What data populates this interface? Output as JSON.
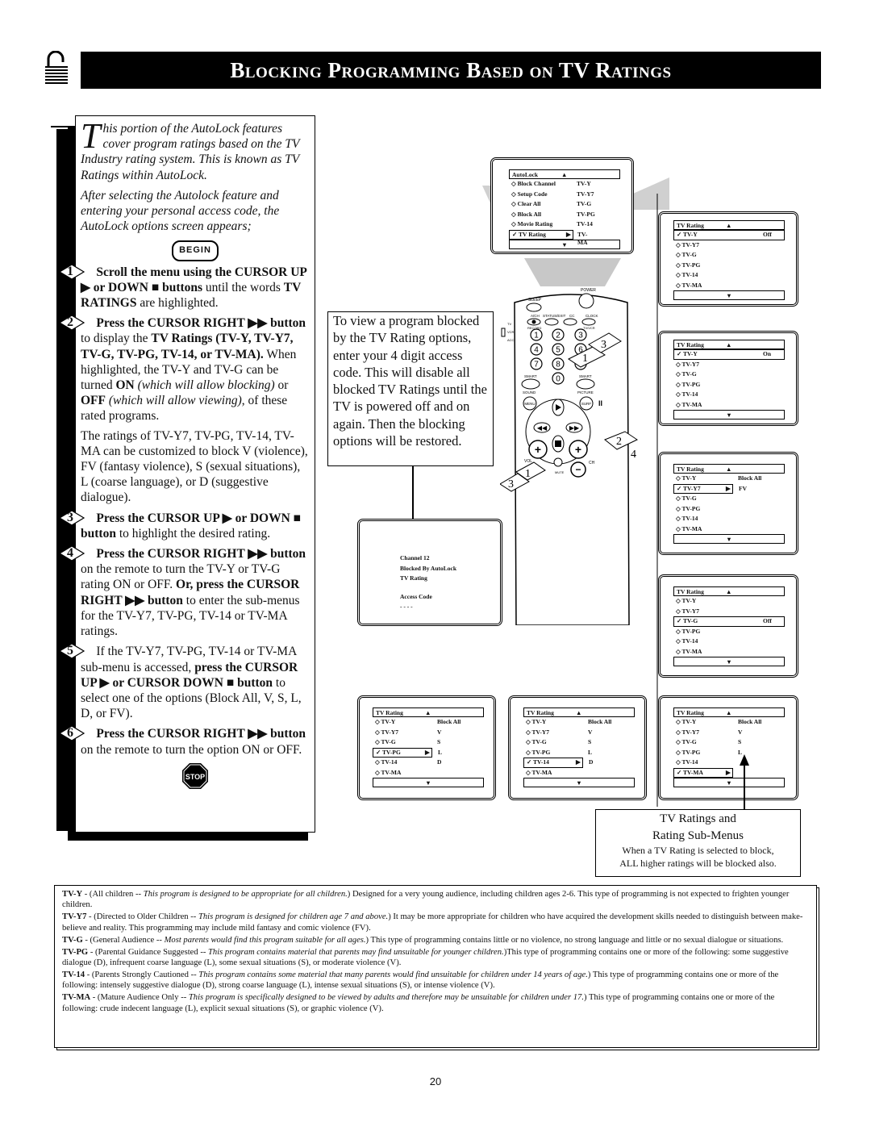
{
  "header": {
    "title": "Blocking Programming Based on TV Ratings",
    "icon": "padlock-icon"
  },
  "instructions": {
    "intro_dropcap": "T",
    "intro_1": "his portion of the AutoLock features cover program ratings based on the TV Industry rating system. This is known as TV Ratings within AutoLock.",
    "intro_2": "After selecting the Autolock feature and entering your personal access code, the AutoLock options screen appears;",
    "begin_label": "BEGIN",
    "steps": [
      {
        "num": "1",
        "bold": "Scroll the menu using the CURSOR UP ▶ or DOWN ■ buttons",
        "text": " until the words ",
        "bold2": "TV RATINGS",
        "text2": " are highlighted."
      },
      {
        "num": "2",
        "bold": "Press the CURSOR RIGHT ▶▶ button",
        "text": " to display the ",
        "bold2": "TV Ratings (TV-Y, TV-Y7, TV-G, TV-PG, TV-14, or TV-MA).",
        "text2": " When highlighted, the TV-Y and TV-G can be turned ",
        "bold3": "ON",
        "ital3": " (which will allow blocking)",
        "text3": " or ",
        "bold4": "OFF",
        "ital4": " (which will allow viewing)",
        "text4": ", of these rated programs.",
        "extra": "The ratings of TV-Y7, TV-PG, TV-14, TV-MA can be customized to block V (violence), FV (fantasy violence), S (sexual situations), L (coarse language), or D (suggestive dialogue)."
      },
      {
        "num": "3",
        "bold": "Press the CURSOR UP ▶ or DOWN ■ button",
        "text": " to highlight the desired rating."
      },
      {
        "num": "4",
        "bold": "Press the CURSOR RIGHT ▶▶ button",
        "text": " on the remote to turn the TV-Y or TV-G rating ON or OFF. ",
        "bold2": "Or, press the CURSOR RIGHT ▶▶ button",
        "text2": " to enter the sub-menus for the TV-Y7, TV-PG, TV-14 or TV-MA ratings."
      },
      {
        "num": "5",
        "text": "If the TV-Y7, TV-PG, TV-14 or TV-MA sub-menu is accessed, ",
        "bold": "press the CURSOR UP ▶ or CURSOR DOWN ■ button",
        "text2": " to select one of the options (Block All, V, S, L, D, or FV)."
      },
      {
        "num": "6",
        "bold": "Press the CURSOR RIGHT ▶▶ button",
        "text": " on the remote to turn the option ON or OFF."
      }
    ],
    "stop_label": "STOP"
  },
  "infobox": {
    "text": "To view a program blocked by the TV Rating options, enter your 4 digit access code. This will disable all blocked TV Ratings until the TV is powered off and on again. Then the blocking options will be restored."
  },
  "autolock_menu": {
    "header": "AutoLock",
    "items": [
      {
        "label": "Block Channel",
        "value": "TV-Y"
      },
      {
        "label": "Setup Code",
        "value": "TV-Y7"
      },
      {
        "label": "Clear All",
        "value": "TV-G"
      },
      {
        "label": "Block All",
        "value": "TV-PG"
      },
      {
        "label": "Movie Rating",
        "value": "TV-14"
      },
      {
        "label": "TV Rating",
        "value": "TV-MA",
        "selected": true
      }
    ]
  },
  "blocked_screen": {
    "line1": "Channel 12",
    "line2": "Blocked By AutoLock",
    "line3": "TV Rating",
    "line4": "Access Code",
    "line5": "- - - -"
  },
  "rating_menus": [
    {
      "header": "TV Rating",
      "rows": [
        {
          "label": "TV-Y",
          "value": "Off",
          "selected": true
        },
        {
          "label": "TV-Y7",
          "value": ""
        },
        {
          "label": "TV-G",
          "value": ""
        },
        {
          "label": "TV-PG",
          "value": ""
        },
        {
          "label": "TV-14",
          "value": ""
        },
        {
          "label": "TV-MA",
          "value": ""
        }
      ]
    },
    {
      "header": "TV Rating",
      "rows": [
        {
          "label": "TV-Y",
          "value": "On",
          "selected": true
        },
        {
          "label": "TV-Y7",
          "value": ""
        },
        {
          "label": "TV-G",
          "value": ""
        },
        {
          "label": "TV-PG",
          "value": ""
        },
        {
          "label": "TV-14",
          "value": ""
        },
        {
          "label": "TV-MA",
          "value": ""
        }
      ]
    },
    {
      "header": "TV Rating",
      "rows": [
        {
          "label": "TV-Y",
          "value": "Block All"
        },
        {
          "label": "TV-Y7",
          "value": "FV",
          "selected": true,
          "arrow": true
        },
        {
          "label": "TV-G",
          "value": ""
        },
        {
          "label": "TV-PG",
          "value": ""
        },
        {
          "label": "TV-14",
          "value": ""
        },
        {
          "label": "TV-MA",
          "value": ""
        }
      ]
    },
    {
      "header": "TV Rating",
      "rows": [
        {
          "label": "TV-Y",
          "value": ""
        },
        {
          "label": "TV-Y7",
          "value": ""
        },
        {
          "label": "TV-G",
          "value": "Off",
          "selected": true
        },
        {
          "label": "TV-PG",
          "value": ""
        },
        {
          "label": "TV-14",
          "value": ""
        },
        {
          "label": "TV-MA",
          "value": ""
        }
      ]
    },
    {
      "header": "TV Rating",
      "rows": [
        {
          "label": "TV-Y",
          "value": "Block All"
        },
        {
          "label": "TV-Y7",
          "value": "V"
        },
        {
          "label": "TV-G",
          "value": "S"
        },
        {
          "label": "TV-PG",
          "value": "L",
          "selected": true,
          "arrow": true
        },
        {
          "label": "TV-14",
          "value": "D"
        },
        {
          "label": "TV-MA",
          "value": ""
        }
      ]
    },
    {
      "header": "TV Rating",
      "rows": [
        {
          "label": "TV-Y",
          "value": "Block All"
        },
        {
          "label": "TV-Y7",
          "value": "V"
        },
        {
          "label": "TV-G",
          "value": "S"
        },
        {
          "label": "TV-PG",
          "value": "L"
        },
        {
          "label": "TV-14",
          "value": "D",
          "selected": true,
          "arrow": true
        },
        {
          "label": "TV-MA",
          "value": ""
        }
      ]
    },
    {
      "header": "TV Rating",
      "rows": [
        {
          "label": "TV-Y",
          "value": "Block All"
        },
        {
          "label": "TV-Y7",
          "value": "V"
        },
        {
          "label": "TV-G",
          "value": "S"
        },
        {
          "label": "TV-PG",
          "value": "L"
        },
        {
          "label": "TV-14",
          "value": ""
        },
        {
          "label": "TV-MA",
          "value": "",
          "selected": true,
          "arrow": true
        }
      ]
    }
  ],
  "remote": {
    "labels": {
      "sleep": "SLEEP",
      "power": "POWER",
      "ach": "A/CH",
      "status": "STATUS/EXIT",
      "cc": "CC",
      "clock": "CLOCK",
      "record": "RECORD",
      "tvvcr": "TV/VCR",
      "tv": "TV",
      "vcr": "VCR",
      "acc": "ACC",
      "smart1": "SMART",
      "smart2": "SMART",
      "sound": "SOUND",
      "picture": "PICTURE",
      "menu": "MENU",
      "surf": "SURF",
      "vol": "VOL",
      "ch": "CH",
      "mute": "MUTE"
    },
    "digits": [
      "1",
      "2",
      "3",
      "4",
      "5",
      "6",
      "7",
      "8",
      "9",
      "0"
    ],
    "step_callouts": [
      "1",
      "3",
      "2",
      "4",
      "3",
      "1"
    ]
  },
  "caption": {
    "title1": "TV Ratings and",
    "title2": "Rating Sub-Menus",
    "note1": "When a TV Rating is selected to block,",
    "note2": "ALL higher ratings will be blocked also."
  },
  "definitions": [
    {
      "term": "TV-Y",
      "plain1": " - (All children -- ",
      "italic": "This program is designed to be appropriate for all children.",
      "plain2": ") Designed for a very young audience, including children ages 2-6. This type of programming is not expected to frighten younger children."
    },
    {
      "term": "TV-Y7",
      "plain1": " - (Directed to Older Children -- ",
      "italic": "This program is designed for children age 7 and above.",
      "plain2": ") It may be more appropriate for children who have acquired the development skills needed to distinguish between make-believe and reality. This programming may include mild fantasy and comic violence (FV)."
    },
    {
      "term": "TV-G",
      "plain1": " - (General Audience -- ",
      "italic": "Most parents would find this program suitable for all ages.",
      "plain2": ") This type of programming contains little or no violence, no strong language and little or no sexual dialogue or situations."
    },
    {
      "term": "TV-PG",
      "plain1": " - (Parental Guidance Suggested -- ",
      "italic": "This program contains material that parents may find unsuitable for younger children.",
      "plain2": ")This type of programming contains one or more of the following: some suggestive dialogue (D), infrequent coarse language (L), some sexual situations (S), or moderate violence (V)."
    },
    {
      "term": "TV-14",
      "plain1": " - (Parents Strongly Cautioned -- ",
      "italic": "This program contains some material that many parents would find unsuitable for children under 14 years of age.",
      "plain2": ") This type of programming contains one or more of the following: intensely suggestive dialogue (D), strong coarse language (L), intense sexual situations (S), or intense violence (V)."
    },
    {
      "term": "TV-MA",
      "plain1": " - (Mature Audience Only -- ",
      "italic": "This program is specifically designed to be viewed by adults and therefore may be unsuitable for children under 17.",
      "plain2": ") This type of programming contains one or more of the following: crude indecent language (L), explicit sexual situations (S), or graphic violence (V)."
    }
  ],
  "page_number": "20"
}
